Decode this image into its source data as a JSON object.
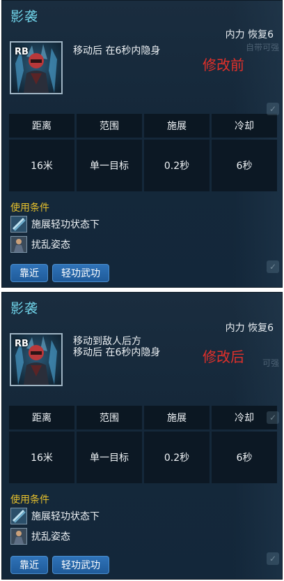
{
  "panels": [
    {
      "title": "影袭",
      "cost": "内力 恢复6",
      "ghost": "自带可强",
      "icon_label": "RB",
      "desc_lines": [
        "移动后 在6秒内隐身"
      ],
      "tag": "修改前",
      "stats": {
        "headers": [
          "距离",
          "范围",
          "施展",
          "冷却"
        ],
        "values": [
          "16米",
          "单一目标",
          "0.2秒",
          "6秒"
        ]
      },
      "conditions_title": "使用条件",
      "conditions": [
        "施展轻功状态下",
        "扰乱姿态"
      ],
      "buttons": [
        "靠近",
        "轻功武功"
      ]
    },
    {
      "title": "影袭",
      "cost": "内力 恢复6",
      "ghost": "可强",
      "icon_label": "RB",
      "desc_lines": [
        "移动到敌人后方",
        "移动后 在6秒内隐身"
      ],
      "tag": "修改后",
      "stats": {
        "headers": [
          "距离",
          "范围",
          "施展",
          "冷却"
        ],
        "values": [
          "16米",
          "单一目标",
          "0.2秒",
          "6秒"
        ]
      },
      "conditions_title": "使用条件",
      "conditions": [
        "施展轻功状态下",
        "扰乱姿态"
      ],
      "buttons": [
        "靠近",
        "轻功武功"
      ]
    }
  ]
}
